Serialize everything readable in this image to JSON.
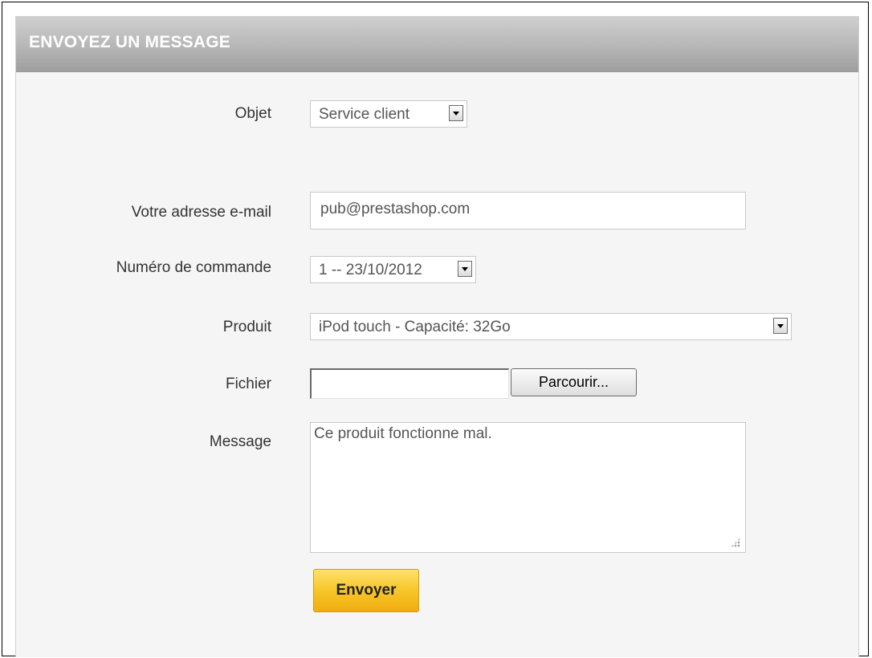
{
  "header": {
    "title": "ENVOYEZ UN MESSAGE"
  },
  "form": {
    "subject": {
      "label": "Objet",
      "value": "Service client"
    },
    "email": {
      "label": "Votre adresse e-mail",
      "value": "pub@prestashop.com"
    },
    "order": {
      "label": "Numéro de commande",
      "value": "1 -- 23/10/2012"
    },
    "product": {
      "label": "Produit",
      "value": "iPod touch - Capacité: 32Go"
    },
    "file": {
      "label": "Fichier",
      "browse_label": "Parcourir..."
    },
    "message": {
      "label": "Message",
      "value": "Ce produit fonctionne mal."
    },
    "submit_label": "Envoyer"
  },
  "colors": {
    "header_gradient_top": "#cfcfcf",
    "header_gradient_bottom": "#9d9d9d",
    "submit_button": "#f8c52b"
  }
}
